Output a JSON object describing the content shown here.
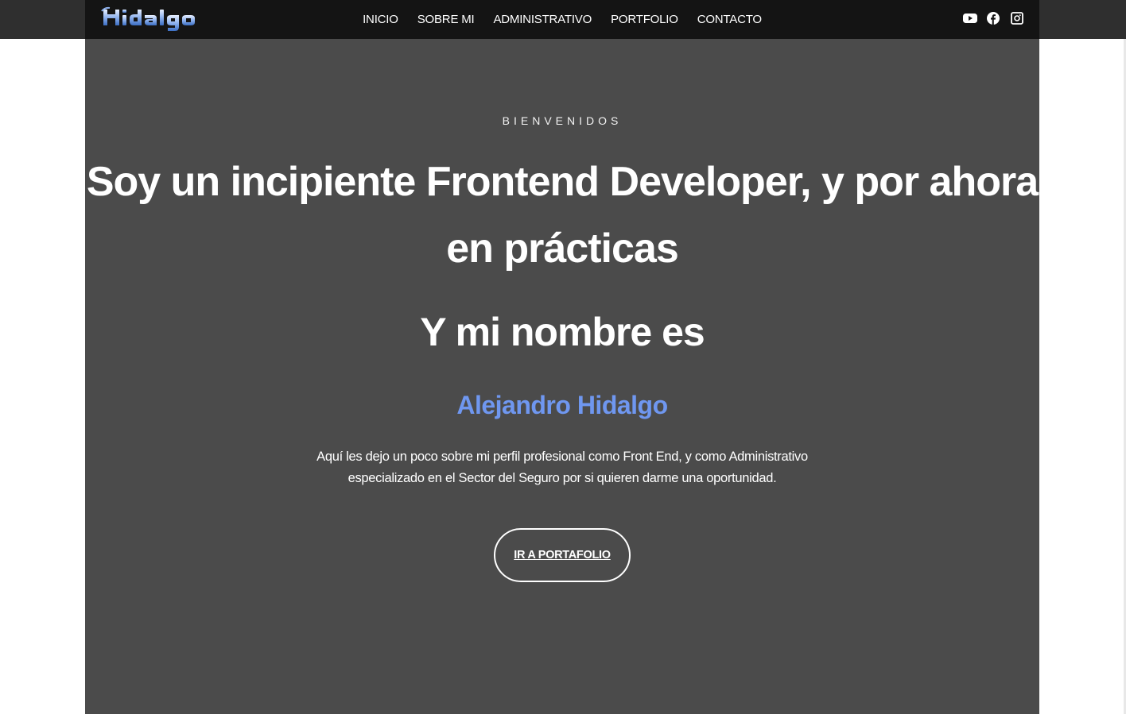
{
  "header": {
    "logo_text": "Hidalgo",
    "nav": [
      {
        "label": "INICIO"
      },
      {
        "label": "SOBRE MI"
      },
      {
        "label": "ADMINISTRATIVO"
      },
      {
        "label": "PORTFOLIO"
      },
      {
        "label": "CONTACTO"
      }
    ],
    "social": [
      "youtube-icon",
      "facebook-icon",
      "instagram-icon"
    ]
  },
  "hero": {
    "eyebrow": "BIENVENIDOS",
    "headline": "Soy un incipiente Frontend Developer, y por ahora en prácticas",
    "sub_headline": "Y mi nombre es",
    "name": "Alejandro Hidalgo",
    "description": "Aquí les dejo un poco sobre mi perfil profesional como Front End, y como Administrativo especializado en el Sector del Seguro por si quieren darme una oportunidad.",
    "cta_label": "IR A PORTAFOLIO"
  },
  "colors": {
    "nav_bg": "#141414",
    "hero_bg": "#4b4b4b",
    "accent_name": "#6f97f0",
    "logo_blue": "#4d7fd0"
  }
}
